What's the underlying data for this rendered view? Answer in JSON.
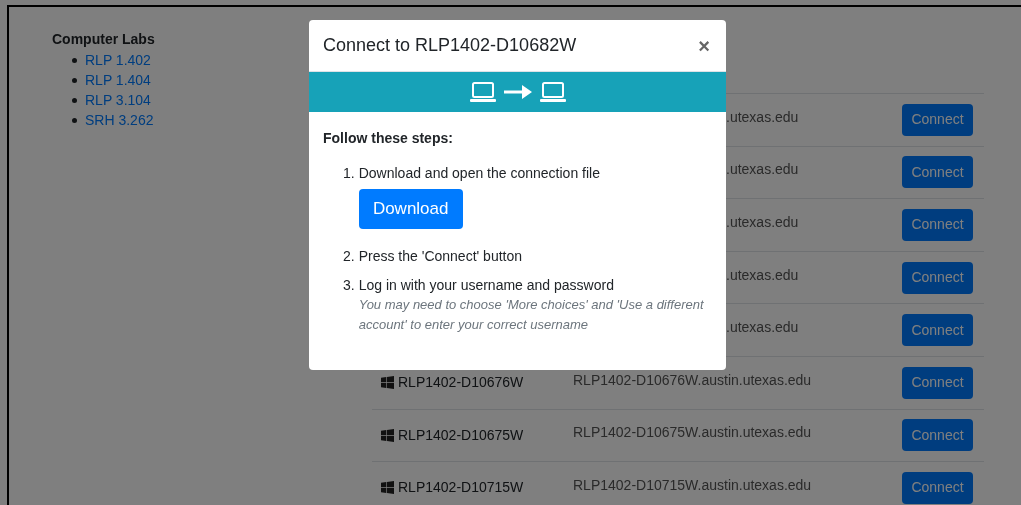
{
  "sidebar": {
    "title": "Computer Labs",
    "items": [
      "RLP 1.402",
      "RLP 1.404",
      "RLP 3.104",
      "SRH 3.262"
    ]
  },
  "machines": [
    {
      "address": ".utexas.edu",
      "button": "Connect"
    },
    {
      "address": ".utexas.edu",
      "button": "Connect"
    },
    {
      "address": ".utexas.edu",
      "button": "Connect"
    },
    {
      "address": ".utexas.edu",
      "button": "Connect"
    },
    {
      "address": ".utexas.edu",
      "button": "Connect"
    },
    {
      "name": "RLP1402-D10676W",
      "address": "RLP1402-D10676W.austin.utexas.edu",
      "button": "Connect"
    },
    {
      "name": "RLP1402-D10675W",
      "address": "RLP1402-D10675W.austin.utexas.edu",
      "button": "Connect"
    },
    {
      "name": "RLP1402-D10715W",
      "address": "RLP1402-D10715W.austin.utexas.edu",
      "button": "Connect"
    }
  ],
  "modal": {
    "title": "Connect to RLP1402-D10682W",
    "close": "×",
    "heading": "Follow these steps:",
    "steps": [
      {
        "number": "1.",
        "text": "Download and open the connection file",
        "button": "Download"
      },
      {
        "number": "2.",
        "text": "Press the 'Connect' button"
      },
      {
        "number": "3.",
        "text": "Log in with your username and password",
        "note": "You may need to choose 'More choices' and 'Use a different account' to enter your correct username"
      }
    ]
  }
}
